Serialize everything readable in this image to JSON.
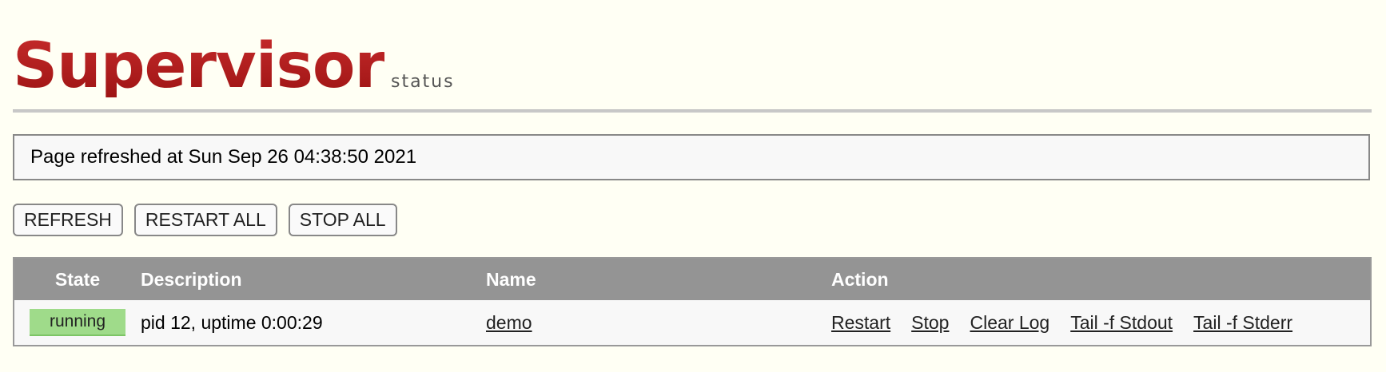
{
  "header": {
    "logo_main": "Supervisor",
    "logo_sub": "status"
  },
  "status": {
    "message": "Page refreshed at Sun Sep 26 04:38:50 2021"
  },
  "toolbar": {
    "refresh_label": "REFRESH",
    "restart_all_label": "RESTART ALL",
    "stop_all_label": "STOP ALL"
  },
  "table": {
    "headers": {
      "state": "State",
      "description": "Description",
      "name": "Name",
      "action": "Action"
    },
    "rows": [
      {
        "state": "running",
        "description": "pid 12, uptime 0:00:29",
        "name": "demo",
        "actions": [
          "Restart",
          "Stop",
          "Clear Log",
          "Tail -f Stdout",
          "Tail -f Stderr"
        ]
      }
    ]
  },
  "colors": {
    "background": "#fffff4",
    "logo_red": "#b01c1c",
    "header_gray": "#949494",
    "running_green": "#9fdb8a"
  }
}
